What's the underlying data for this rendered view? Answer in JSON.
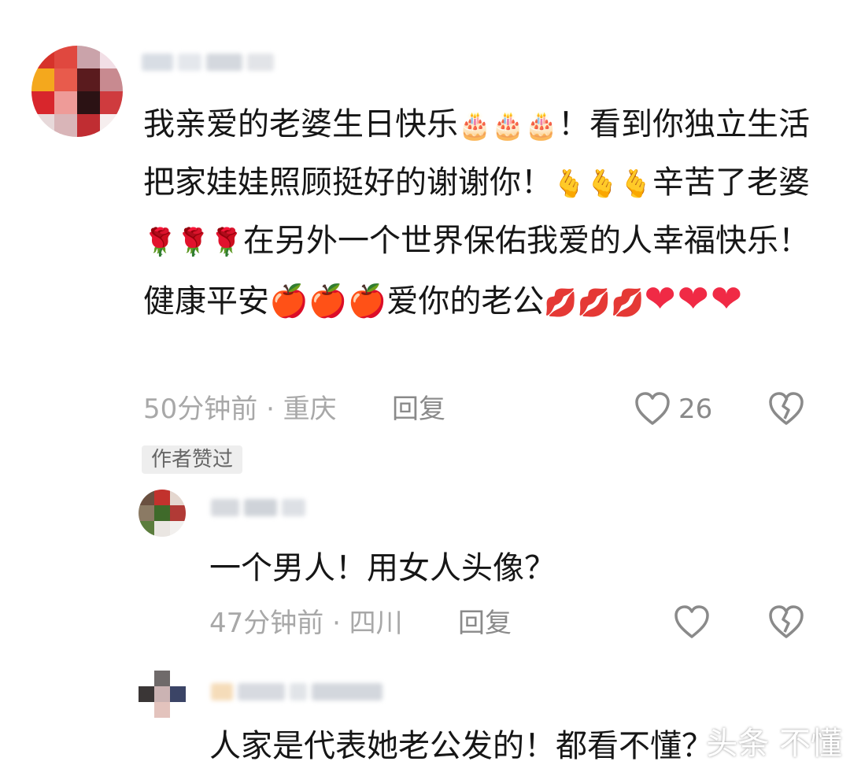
{
  "comments": [
    {
      "username": "",
      "segments": [
        "我亲爱的老婆生日快乐",
        "🎂🎂🎂",
        "！看到你独立生活把家娃娃照顾挺好的谢谢你！",
        "🫰🫰🫰",
        "辛苦了老婆",
        "🌹🌹🌹",
        "在另外一个世界保佑我爱的人幸福快乐！健康平安",
        "🍎🍎🍎",
        "爱你的老公",
        "💋💋💋",
        "❤❤❤"
      ],
      "time_location": "50分钟前 · 重庆",
      "reply_label": "回复",
      "like_count": "26",
      "badge": "作者赞过"
    },
    {
      "username": "",
      "text": "一个男人！用女人头像？",
      "time_location": "47分钟前 · 四川",
      "reply_label": "回复"
    },
    {
      "username": "",
      "text": "人家是代表她老公发的！都看不懂？"
    }
  ],
  "watermark": "头条 不懂",
  "icons": {
    "like": "heart-outline-icon",
    "dislike": "broken-heart-icon"
  },
  "colors": {
    "text": "#161616",
    "meta": "#a8a8a8",
    "reply": "#8a8a8a",
    "badge_bg": "#eeeeee"
  }
}
